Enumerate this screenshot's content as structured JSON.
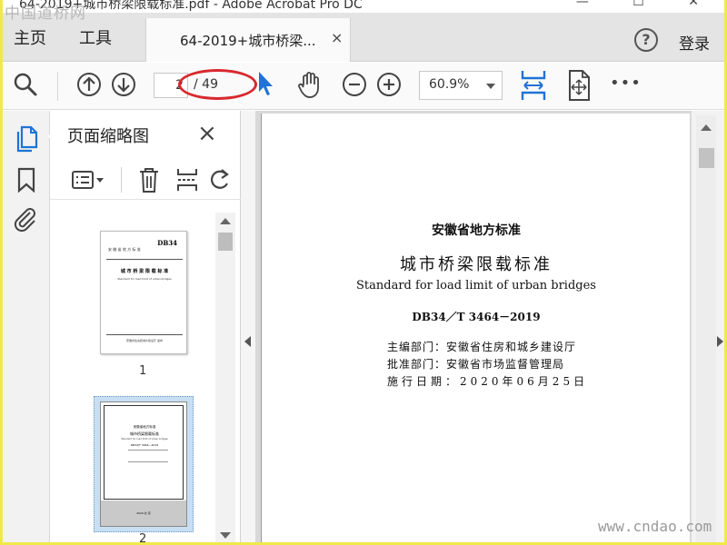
{
  "window": {
    "title": "64-2019+城市桥梁限载标准.pdf - Adobe Acrobat Pro DC",
    "controls": "—  ☐  ✕"
  },
  "watermarks": {
    "top_left": "中国道桥网",
    "bottom_right": "www.cndao.com"
  },
  "menubar": {
    "home": "主页",
    "tools": "工具",
    "tab_label": "64-2019+城市桥梁...",
    "tab_close": "×",
    "help": "?",
    "login": "登录"
  },
  "toolbar": {
    "current_page": "2",
    "total_pages": "/ 49",
    "zoom": "60.9%",
    "more": "•••"
  },
  "thumbnails": {
    "title": "页面缩略图",
    "close": "×",
    "pages": [
      {
        "number": "1"
      },
      {
        "number": "2"
      }
    ]
  },
  "thumb_page1": {
    "code": "DB34",
    "header_left": "安 徽 省 地 方 标 准",
    "title": "城 市 桥 梁 限 载 标 准",
    "subtitle": "Standard for load limit of urban bridges",
    "footer": "安徽省住房和城乡建设厅  发布"
  },
  "thumb_page2": {
    "org": "安徽省地方标准",
    "title": "城市桥梁限载标准",
    "subtitle": "Standard for load limit of urban bridges",
    "code": "DB34/T 3464—2019",
    "footer": "2020 北 京"
  },
  "document": {
    "org": "安徽省地方标准",
    "title_cn": "城市桥梁限载标准",
    "title_en": "Standard for load limit of urban bridges",
    "code": "DB34／T 3464－2019",
    "editor": "主编部门：安徽省住房和城乡建设厅",
    "approver": "批准部门：安徽省市场监督管理局",
    "effective": "施行日期：2020年06月25日"
  },
  "colors": {
    "accent_blue": "#1f73d6",
    "annotation_red": "#d8292f",
    "frame_yellow": "#f0e94a"
  }
}
